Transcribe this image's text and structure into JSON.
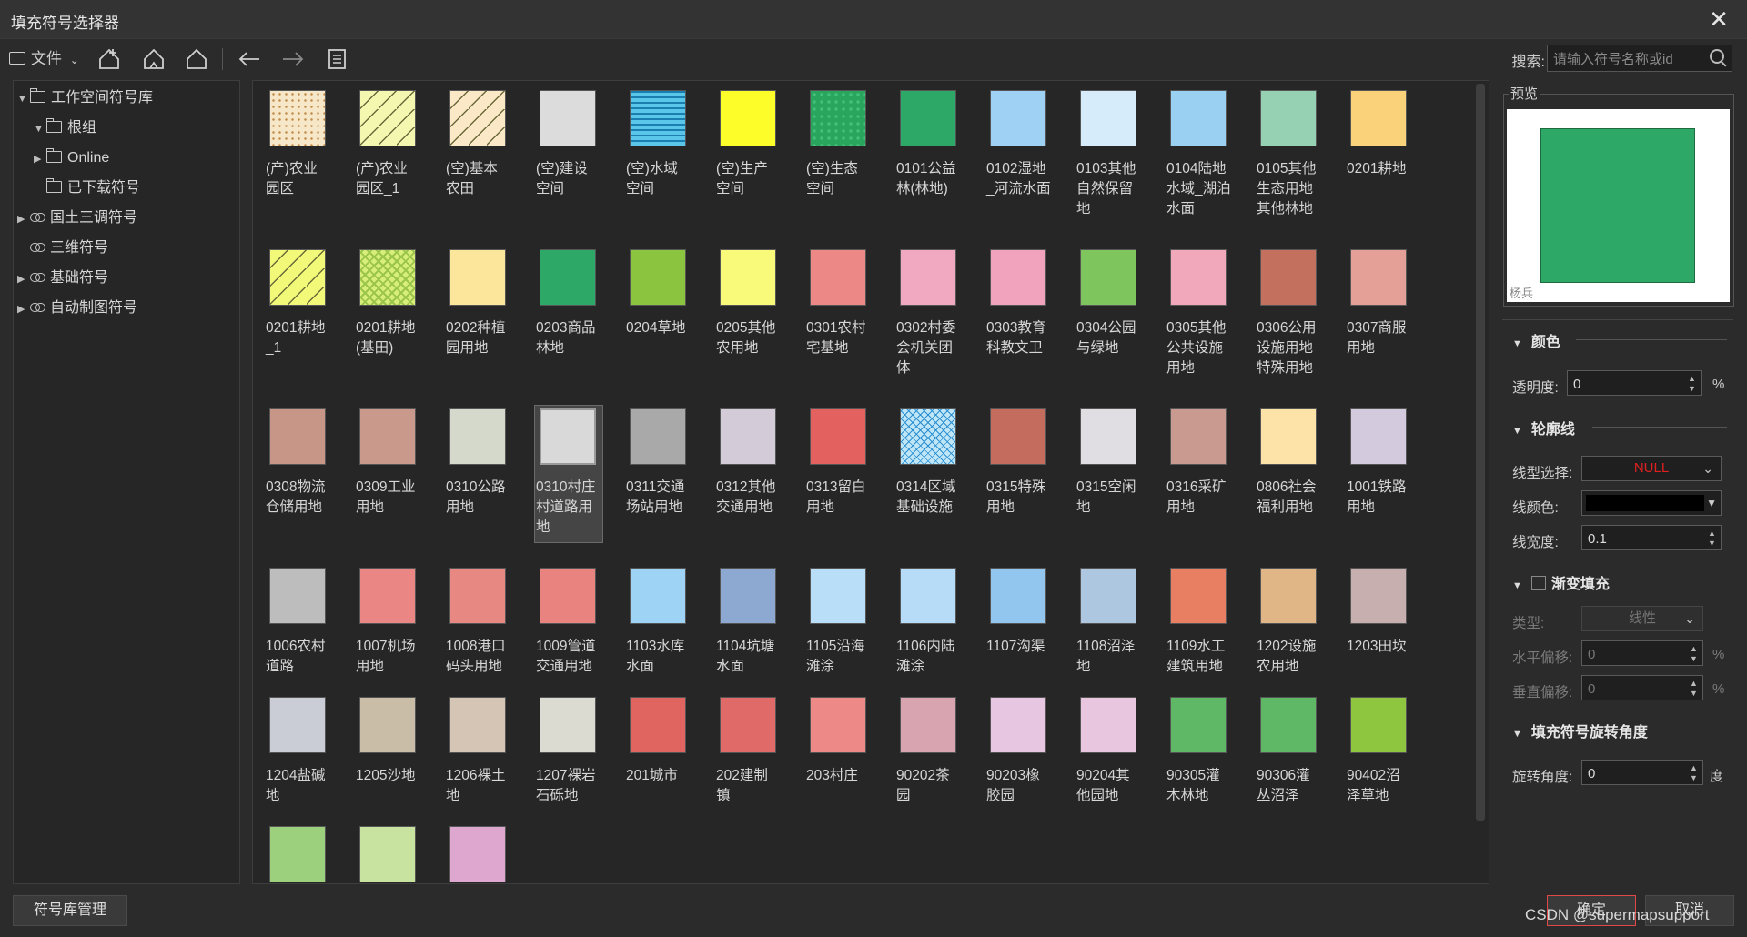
{
  "window": {
    "title": "填充符号选择器",
    "close_glyph": "✕"
  },
  "toolbar": {
    "file_label": "文件",
    "file_chevron": "⌄"
  },
  "search": {
    "label": "搜索:",
    "placeholder": "请输入符号名称或id"
  },
  "tree": [
    {
      "label": "工作空间符号库",
      "arrow": "▼",
      "icon": "folder-icon"
    },
    {
      "label": "根组",
      "arrow": "▼",
      "icon": "folder-icon"
    },
    {
      "label": "Online",
      "arrow": "▶",
      "icon": "folder-icon"
    },
    {
      "label": "已下载符号",
      "arrow": "",
      "icon": "folder-icon"
    },
    {
      "label": "国土三调符号",
      "arrow": "▶",
      "icon": "link-icon"
    },
    {
      "label": "三维符号",
      "arrow": "",
      "icon": "link-icon"
    },
    {
      "label": "基础符号",
      "arrow": "▶",
      "icon": "link-icon"
    },
    {
      "label": "自动制图符号",
      "arrow": "▶",
      "icon": "link-icon"
    }
  ],
  "symbols": [
    {
      "label": "(产)农业园区",
      "color": "#f6e7c8",
      "pattern": "dots"
    },
    {
      "label": "(产)农业园区_1",
      "color": "#f4f7b0",
      "pattern": "leaf"
    },
    {
      "label": "(空)基本农田",
      "color": "#fbe8c6",
      "pattern": "leaf"
    },
    {
      "label": "(空)建设空间",
      "color": "#dcdcdc",
      "pattern": ""
    },
    {
      "label": "(空)水域空间",
      "color": "#59c6ea",
      "pattern": "wave"
    },
    {
      "label": "(空)生产空间",
      "color": "#fdfd2a",
      "pattern": ""
    },
    {
      "label": "(空)生态空间",
      "color": "#2aa55d",
      "pattern": "dotsg"
    },
    {
      "label": "0101公益林(林地)",
      "color": "#2ea866",
      "pattern": ""
    },
    {
      "label": "0102湿地_河流水面",
      "color": "#9ed1f4",
      "pattern": ""
    },
    {
      "label": "0103其他自然保留地",
      "color": "#d6ecfb",
      "pattern": ""
    },
    {
      "label": "0104陆地水域_湖泊水面",
      "color": "#9ad0f2",
      "pattern": ""
    },
    {
      "label": "0105其他生态用地其他林地",
      "color": "#97d1b3",
      "pattern": ""
    },
    {
      "label": "0201耕地",
      "color": "#f9d27a",
      "pattern": ""
    },
    {
      "label": "0201耕地_1",
      "color": "#f2f978",
      "pattern": "leaf"
    },
    {
      "label": "0201耕地(基田)",
      "color": "#d8ee7a",
      "pattern": "cross"
    },
    {
      "label": "0202种植园用地",
      "color": "#fbe69b",
      "pattern": ""
    },
    {
      "label": "0203商品林地",
      "color": "#2ea866",
      "pattern": ""
    },
    {
      "label": "0204草地",
      "color": "#8bc53f",
      "pattern": ""
    },
    {
      "label": "0205其他农用地",
      "color": "#fafa7a",
      "pattern": ""
    },
    {
      "label": "0301农村宅基地",
      "color": "#ec8986",
      "pattern": ""
    },
    {
      "label": "0302村委会机关团体",
      "color": "#f1a9c1",
      "pattern": ""
    },
    {
      "label": "0303教育科教文卫",
      "color": "#f1a3be",
      "pattern": ""
    },
    {
      "label": "0304公园与绿地",
      "color": "#7fc55e",
      "pattern": ""
    },
    {
      "label": "0305其他公共设施用地",
      "color": "#f2a8bb",
      "pattern": ""
    },
    {
      "label": "0306公用设施用地特殊用地",
      "color": "#c4705f",
      "pattern": ""
    },
    {
      "label": "0307商服用地",
      "color": "#e4a096",
      "pattern": ""
    },
    {
      "label": "0308物流仓储用地",
      "color": "#c89686",
      "pattern": ""
    },
    {
      "label": "0309工业用地",
      "color": "#c99a8c",
      "pattern": ""
    },
    {
      "label": "0310公路用地",
      "color": "#d5d9cc",
      "pattern": ""
    },
    {
      "label": "0310村庄村道路用地",
      "color": "#d9d9d9",
      "pattern": "",
      "selected": true
    },
    {
      "label": "0311交通场站用地",
      "color": "#a9a9a9",
      "pattern": ""
    },
    {
      "label": "0312其他交通用地",
      "color": "#d4cbd8",
      "pattern": ""
    },
    {
      "label": "0313留白用地",
      "color": "#e3625f",
      "pattern": ""
    },
    {
      "label": "0314区域基础设施",
      "color": "#bfe6f7",
      "pattern": "hatch"
    },
    {
      "label": "0315特殊用地",
      "color": "#c46d5e",
      "pattern": ""
    },
    {
      "label": "0315空闲地",
      "color": "#e0dde3",
      "pattern": ""
    },
    {
      "label": "0316采矿用地",
      "color": "#c99a8f",
      "pattern": ""
    },
    {
      "label": "0806社会福利用地",
      "color": "#fde3a8",
      "pattern": ""
    },
    {
      "label": "1001铁路用地",
      "color": "#d3cade",
      "pattern": ""
    },
    {
      "label": "1006农村道路",
      "color": "#bdbdbd",
      "pattern": ""
    },
    {
      "label": "1007机场用地",
      "color": "#ea8784",
      "pattern": ""
    },
    {
      "label": "1008港口码头用地",
      "color": "#e88883",
      "pattern": ""
    },
    {
      "label": "1009管道交通用地",
      "color": "#e9837f",
      "pattern": ""
    },
    {
      "label": "1103水库水面",
      "color": "#9fd3f5",
      "pattern": ""
    },
    {
      "label": "1104坑塘水面",
      "color": "#8ea9d1",
      "pattern": ""
    },
    {
      "label": "1105沿海滩涂",
      "color": "#b9dff8",
      "pattern": ""
    },
    {
      "label": "1106内陆滩涂",
      "color": "#b6dcf7",
      "pattern": ""
    },
    {
      "label": "1107沟渠",
      "color": "#93c6ef",
      "pattern": ""
    },
    {
      "label": "1108沼泽地",
      "color": "#adc7e0",
      "pattern": ""
    },
    {
      "label": "1109水工建筑用地",
      "color": "#e87f62",
      "pattern": ""
    },
    {
      "label": "1202设施农用地",
      "color": "#e1b687",
      "pattern": ""
    },
    {
      "label": "1203田坎",
      "color": "#c7aeaf",
      "pattern": ""
    },
    {
      "label": "1204盐碱地",
      "color": "#cacdd6",
      "pattern": ""
    },
    {
      "label": "1205沙地",
      "color": "#c9bda8",
      "pattern": ""
    },
    {
      "label": "1206裸土地",
      "color": "#d4c5b5",
      "pattern": ""
    },
    {
      "label": "1207裸岩石砾地",
      "color": "#dcdbd2",
      "pattern": ""
    },
    {
      "label": "201城市",
      "color": "#e0645f",
      "pattern": ""
    },
    {
      "label": "202建制镇",
      "color": "#e06a67",
      "pattern": ""
    },
    {
      "label": "203村庄",
      "color": "#ed8a88",
      "pattern": ""
    },
    {
      "label": "90202茶园",
      "color": "#d7a4af",
      "pattern": ""
    },
    {
      "label": "90203橡胶园",
      "color": "#e7c6e1",
      "pattern": ""
    },
    {
      "label": "90204其他园地",
      "color": "#e8c6e0",
      "pattern": ""
    },
    {
      "label": "90305灌木林地",
      "color": "#5eb865",
      "pattern": ""
    },
    {
      "label": "90306灌丛沼泽",
      "color": "#5fb866",
      "pattern": ""
    },
    {
      "label": "90402沼泽草地",
      "color": "#8ec63f",
      "pattern": ""
    },
    {
      "label": "",
      "color": "#9dd07c",
      "pattern": ""
    },
    {
      "label": "",
      "color": "#c7e39f",
      "pattern": ""
    },
    {
      "label": "",
      "color": "#dda7cf",
      "pattern": ""
    }
  ],
  "preview": {
    "title": "预览",
    "credit": "杨兵",
    "fill": "#2ea866"
  },
  "color_section": {
    "title": "颜色",
    "transparency_label": "透明度:",
    "transparency_value": "0",
    "unit": "%"
  },
  "outline_section": {
    "title": "轮廓线",
    "linetype_label": "线型选择:",
    "linetype_value": "NULL",
    "linecolor_label": "线颜色:",
    "linecolor": "#000000",
    "linewidth_label": "线宽度:",
    "linewidth_value": "0.1"
  },
  "gradient_section": {
    "title": "渐变填充",
    "type_label": "类型:",
    "type_value": "线性",
    "hoffset_label": "水平偏移:",
    "hoffset_value": "0",
    "voffset_label": "垂直偏移:",
    "voffset_value": "0",
    "unit": "%"
  },
  "rotation_section": {
    "title": "填充符号旋转角度",
    "angle_label": "旋转角度:",
    "angle_value": "0",
    "unit": "度"
  },
  "bottom": {
    "manage_label": "符号库管理",
    "ok_label": "确定",
    "cancel_label": "取消",
    "watermark": "CSDN @supermapsupport"
  }
}
